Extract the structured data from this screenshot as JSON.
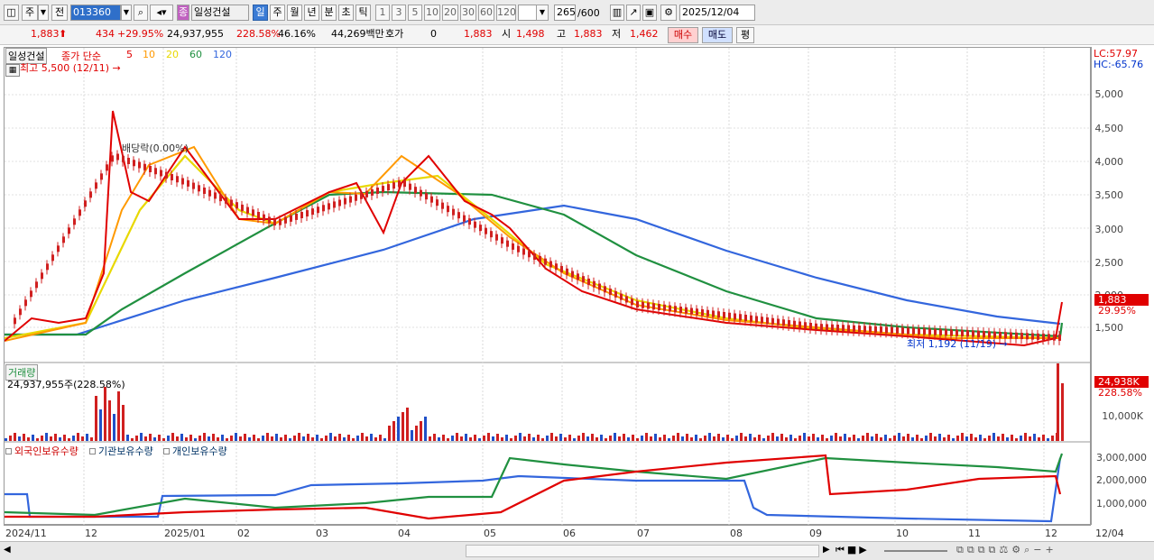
{
  "toolbar": {
    "mode": "주",
    "prev": "전",
    "code": "013360",
    "name": "일성건설",
    "periods": [
      "일",
      "주",
      "월",
      "년",
      "분",
      "초",
      "틱"
    ],
    "ticks": [
      "1",
      "3",
      "5",
      "10",
      "20",
      "30",
      "60",
      "120"
    ],
    "count": "265",
    "count_max": "/600",
    "date": "2025/12/04"
  },
  "quote": {
    "price": "1,883",
    "change": "434",
    "change_pct": "+29.95%",
    "volume": "24,937,955",
    "vol_ratio": "228.58%",
    "turnover": "46.16%",
    "amount": "44,269백만",
    "ask_label": "호가",
    "ask_val": "0",
    "ask_price": "1,883",
    "open_label": "시",
    "open": "1,498",
    "high_label": "고",
    "high": "1,883",
    "low_label": "저",
    "low": "1,462",
    "buy": "매수",
    "sell": "매도",
    "avg": "평"
  },
  "price_panel": {
    "stock": "일성건설",
    "legend_label": "종가 단순",
    "ma": [
      "5",
      "10",
      "20",
      "60",
      "120"
    ],
    "ma_colors": [
      "#e00000",
      "#ff9900",
      "#e8d800",
      "#209040",
      "#3366dd"
    ],
    "high_note": "최고 5,500 (12/11) →",
    "low_note": "최저 1,192 (11/19) →",
    "div_note": "배당락(0.00%)",
    "lc": "LC:57.97",
    "hc": "HC:-65.76",
    "last_price": "1,883",
    "last_pct": "29.95%",
    "y_labels": [
      "5,000",
      "4,500",
      "4,000",
      "3,500",
      "3,000",
      "2,500",
      "2,000",
      "1,500"
    ]
  },
  "volume_panel": {
    "title": "거래량",
    "value": "24,937,955주(228.58%)",
    "last": "24,938K",
    "last_pct": "228.58%",
    "y_labels": [
      "10,000K"
    ]
  },
  "holder_panel": {
    "series": [
      "외국인보유수량",
      "기관보유수량",
      "개인보유수량"
    ],
    "colors": [
      "#e00000",
      "#3366dd",
      "#209040"
    ],
    "y_labels": [
      "3,000,000",
      "2,000,000",
      "1,000,000"
    ]
  },
  "x_labels": [
    "2024/11",
    "12",
    "2025/01",
    "02",
    "03",
    "04",
    "05",
    "06",
    "07",
    "08",
    "09",
    "10",
    "11",
    "12",
    "12/04"
  ]
}
